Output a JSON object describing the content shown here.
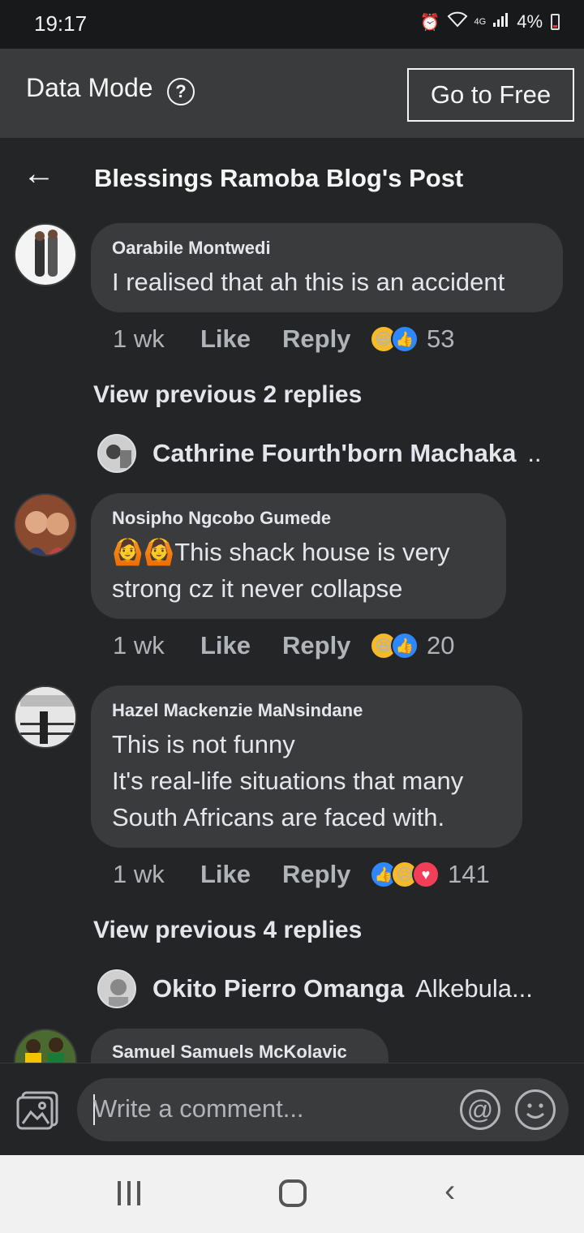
{
  "status_bar": {
    "time": "19:17",
    "network": "4G",
    "battery": "4%"
  },
  "data_mode": {
    "label": "Data Mode",
    "help": "?",
    "go_free": "Go to Free"
  },
  "header": {
    "back": "←",
    "title": "Blessings Ramoba Blog's Post"
  },
  "comments": [
    {
      "author": "Oarabile Montwedi",
      "text": "I realised that ah this is an accident",
      "time": "1 wk",
      "like": "Like",
      "reply": "Reply",
      "reactions": [
        "haha",
        "like"
      ],
      "count": "53"
    },
    {
      "author": "Nosipho Ngcobo Gumede",
      "emoji": "🙆🙆",
      "text": "This shack house is very strong cz it never collapse",
      "time": "1 wk",
      "like": "Like",
      "reply": "Reply",
      "reactions": [
        "haha",
        "like"
      ],
      "count": "20"
    },
    {
      "author": "Hazel Mackenzie MaNsindane",
      "line1": "This is not funny",
      "line2": "It's real-life situations that many",
      "line3": "South Africans are faced with.",
      "time": "1 wk",
      "like": "Like",
      "reply": "Reply",
      "reactions": [
        "like",
        "sad",
        "love"
      ],
      "count": "141"
    },
    {
      "author": "Samuel Samuels McKolavic"
    }
  ],
  "view_prev_1": "View previous 2 replies",
  "reply_preview_1": {
    "name": "Cathrine Fourth'born Machaka",
    "text": ".."
  },
  "view_prev_2": "View previous 4 replies",
  "reply_preview_2": {
    "name": "Okito Pierro Omanga",
    "text": "Alkebula..."
  },
  "composer": {
    "placeholder": "Write a comment...",
    "at": "@"
  },
  "nav": {
    "back": "‹"
  },
  "colors": {
    "background": "#242526",
    "bubble": "#3a3b3c",
    "like_blue": "#2d88ff",
    "haha_yellow": "#f7b928",
    "love_red": "#f33e58"
  }
}
